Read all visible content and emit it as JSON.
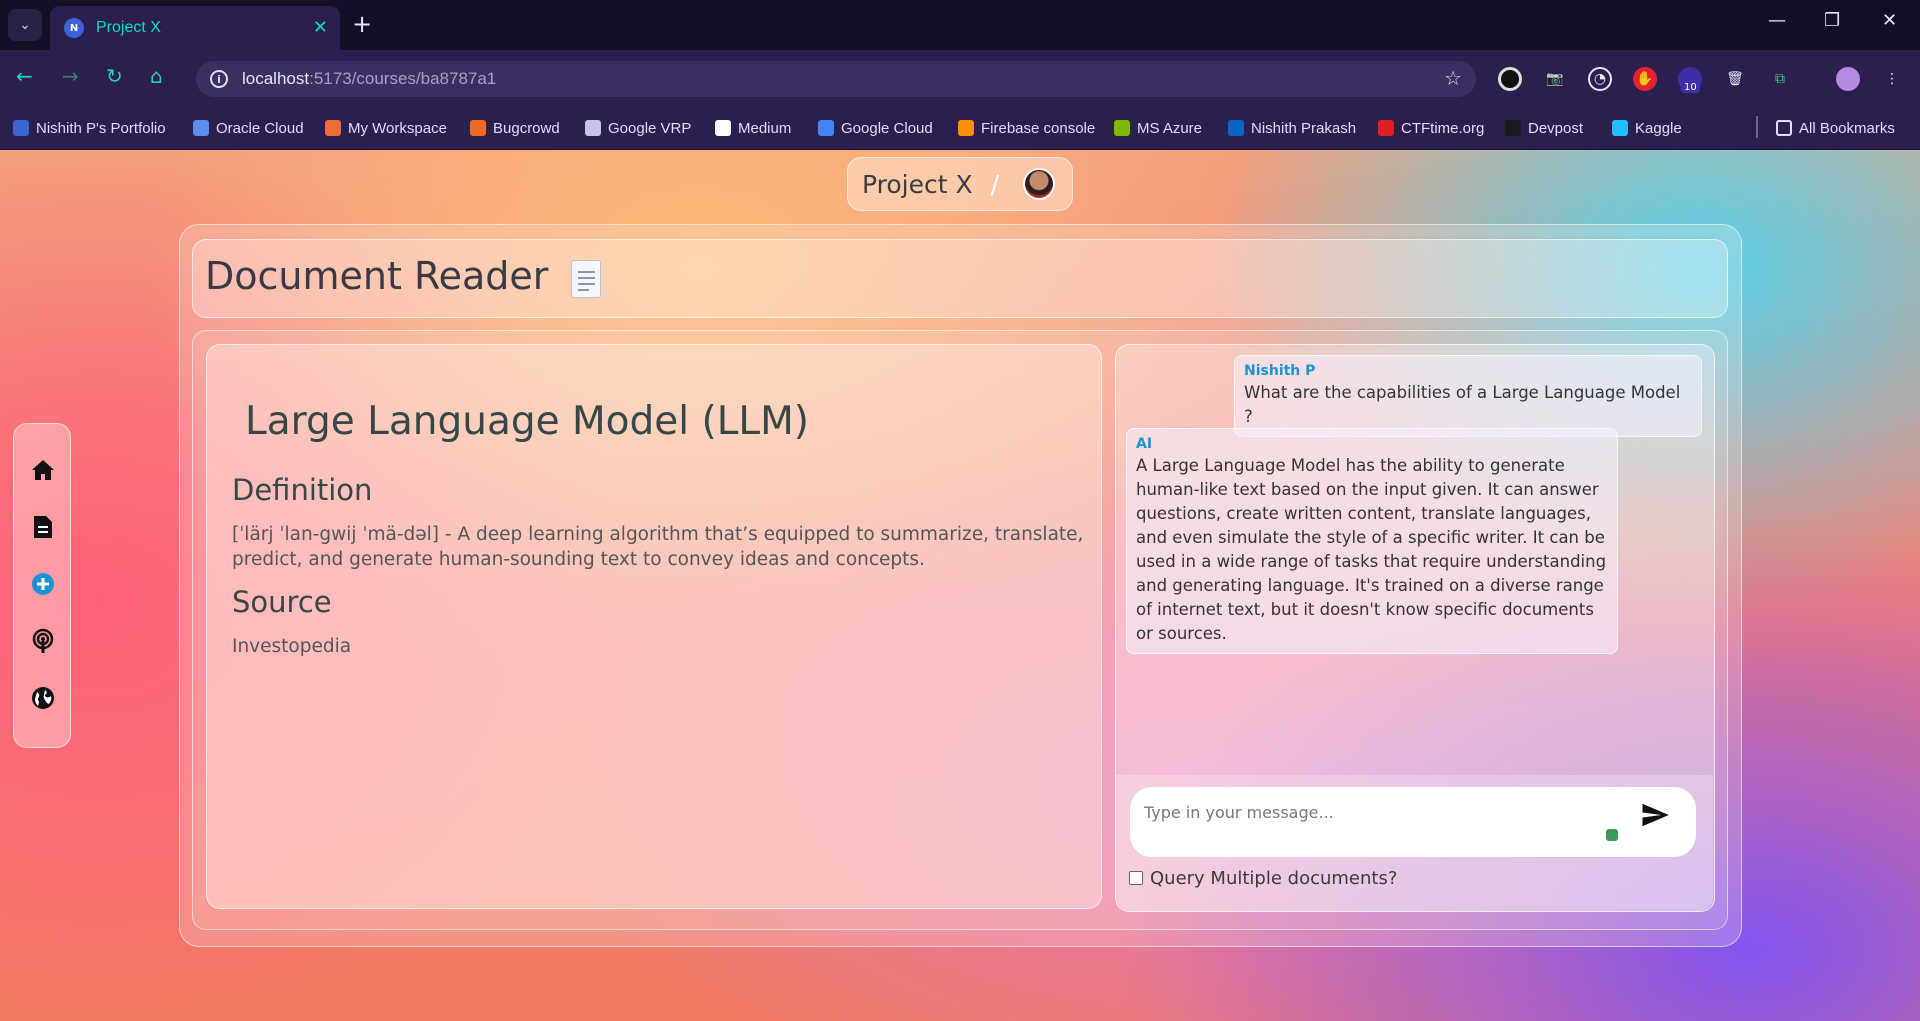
{
  "browser": {
    "tab_title": "Project X",
    "tab_favicon": "N",
    "url_host": "localhost",
    "url_path": ":5173/courses/ba8787a1",
    "extension_badge": "10",
    "bookmarks": [
      {
        "label": "Nishith P's Portfolio",
        "color": "#3d63d6"
      },
      {
        "label": "Oracle Cloud",
        "color": "#5b8def"
      },
      {
        "label": "My Workspace",
        "color": "#f06a3a"
      },
      {
        "label": "Bugcrowd",
        "color": "#f26822"
      },
      {
        "label": "Google VRP",
        "color": "#c9c3e6"
      },
      {
        "label": "Medium",
        "color": "#ffffff"
      },
      {
        "label": "Google Cloud",
        "color": "#4285f4"
      },
      {
        "label": "Firebase console",
        "color": "#ff8f00"
      },
      {
        "label": "MS Azure",
        "color": "#7fba00"
      },
      {
        "label": "Nishith Prakash",
        "color": "#0a66c2"
      },
      {
        "label": "CTFtime.org",
        "color": "#e02020"
      },
      {
        "label": "Devpost",
        "color": "#1a1a1a"
      },
      {
        "label": "Kaggle",
        "color": "#20beff"
      }
    ],
    "all_bookmarks": "All Bookmarks"
  },
  "app": {
    "breadcrumb_title": "Project X",
    "breadcrumb_sep": "/",
    "header_title": "Document Reader"
  },
  "document": {
    "title": "Large Language Model (LLM)",
    "definition_heading": "Definition",
    "definition_text": "[ˈlärj ˈlan-gwij ˈmä-dəl] - A deep learning algorithm that’s equipped to summarize, translate, predict, and generate human-sounding text to convey ideas and concepts.",
    "source_heading": "Source",
    "source_text": "Investopedia"
  },
  "chat": {
    "messages": [
      {
        "sender": "Nishith P",
        "text": "What are the capabilities of a Large Language Model ?"
      },
      {
        "sender": "AI",
        "text": "A Large Language Model has the ability to generate human-like text based on the input given. It can answer questions, create written content, translate languages, and even simulate the style of a specific writer. It can be used in a wide range of tasks that require understanding and generating language. It's trained on a diverse range of internet text, but it doesn't know specific documents or sources."
      }
    ],
    "input_placeholder": "Type in your message...",
    "multi_doc_label": "Query Multiple documents?"
  },
  "sidebar": {
    "icons": [
      "home-icon",
      "document-icon",
      "add-icon",
      "podcast-icon",
      "globe-icon"
    ]
  },
  "colors": {
    "accent": "#00e0c0",
    "chat_name": "#1c92d2",
    "add_icon": "#1c92d2"
  }
}
